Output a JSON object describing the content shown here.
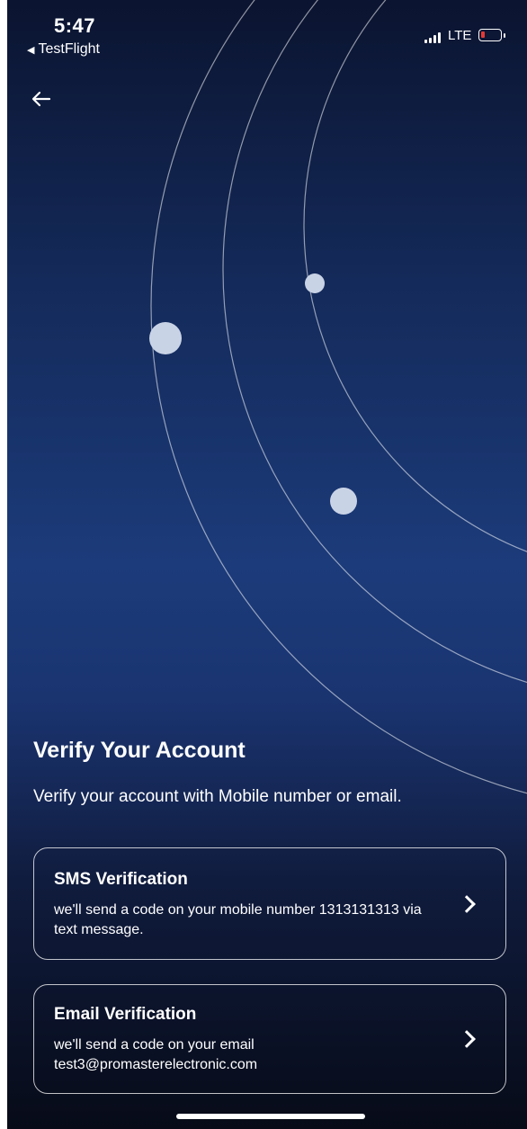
{
  "status_bar": {
    "time": "5:47",
    "back_app": "TestFlight",
    "network": "LTE",
    "battery_color": "#e53935"
  },
  "nav": {
    "back_icon": "arrow-left-icon"
  },
  "title": "Verify Your Account",
  "subtitle": "Verify your account with Mobile number or email.",
  "options": [
    {
      "title": "SMS Verification",
      "description": "we'll send a code on your mobile number 1313131313 via text message.",
      "icon": "chevron-right-icon"
    },
    {
      "title": "Email Verification",
      "description": "we'll send a code on your email test3@promasterelectronic.com",
      "icon": "chevron-right-icon"
    }
  ],
  "colors": {
    "background_top": "#0b1430",
    "background_mid": "#1c3b7a",
    "background_bottom": "#070b18",
    "text": "#ffffff"
  }
}
